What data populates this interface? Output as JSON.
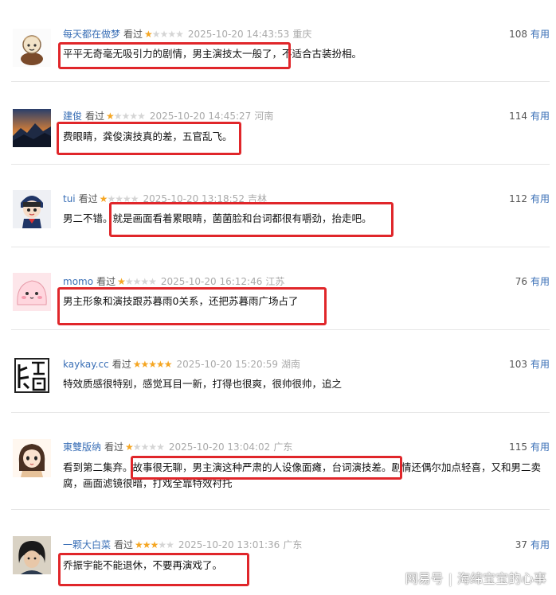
{
  "comments": [
    {
      "user": "每天都在做梦",
      "watched": "看过",
      "rating": 1,
      "date": "2025-10-20 14:43:53",
      "location": "重庆",
      "votes": "108",
      "vote_label": "有用",
      "text": "平平无奇毫无吸引力的剧情，男主演技太一般了，不适合古装扮相。",
      "avatar_icon": "cartoon-avatar-icon"
    },
    {
      "user": "建俊",
      "watched": "看过",
      "rating": 1,
      "date": "2025-10-20 14:45:27",
      "location": "河南",
      "votes": "114",
      "vote_label": "有用",
      "text": "费眼睛，龚俊演技真的差，五官乱飞。",
      "avatar_icon": "landscape-avatar-icon"
    },
    {
      "user": "tui",
      "watched": "看过",
      "rating": 1,
      "date": "2025-10-20 13:18:52",
      "location": "吉林",
      "votes": "112",
      "vote_label": "有用",
      "text": "男二不错。就是画面看着累眼睛，菌菌脸和台词都很有嚼劲，抬走吧。",
      "avatar_icon": "doll-avatar-icon"
    },
    {
      "user": "momo",
      "watched": "看过",
      "rating": 1,
      "date": "2025-10-20 16:12:46",
      "location": "江苏",
      "votes": "76",
      "vote_label": "有用",
      "text": "男主形象和演技跟苏暮雨0关系，还把苏暮雨广场占了",
      "avatar_icon": "pink-blob-avatar-icon"
    },
    {
      "user": "kaykay.cc",
      "watched": "看过",
      "rating": 5,
      "date": "2025-10-20 15:20:59",
      "location": "湖南",
      "votes": "103",
      "vote_label": "有用",
      "text": "特效质感很特别，感觉耳目一新，打得也很爽，很帅很帅，追之",
      "avatar_icon": "calligraphy-avatar-icon"
    },
    {
      "user": "東雙版纳",
      "watched": "看过",
      "rating": 1,
      "date": "2025-10-20 13:04:02",
      "location": "广东",
      "votes": "115",
      "vote_label": "有用",
      "text": "看到第二集弃。故事很无聊，男主演这种严肃的人设像面瘫，台词演技差。剧情还偶尔加点轻喜，又和男二卖腐，画面滤镜很暗，打戏全靠特效衬托",
      "avatar_icon": "anime-girl-avatar-icon"
    },
    {
      "user": "一颗大白菜",
      "watched": "看过",
      "rating": 3,
      "date": "2025-10-20 13:01:36",
      "location": "广东",
      "votes": "37",
      "vote_label": "有用",
      "text": "乔振宇能不能退休，不要再演戏了。",
      "avatar_icon": "portrait-avatar-icon"
    }
  ],
  "watermark": {
    "brand": "网易号",
    "author": "海绵宝宝的心事"
  }
}
